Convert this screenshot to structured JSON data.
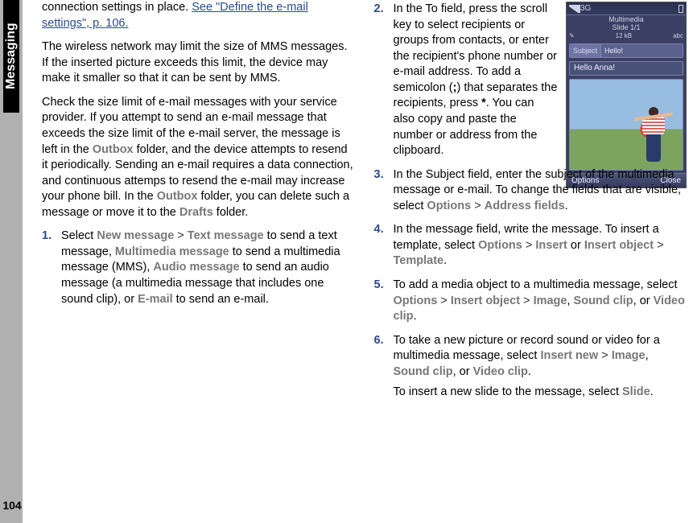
{
  "sideTab": "Messaging",
  "pageNumber": "104",
  "leftCol": {
    "para1_a": "connection settings in place. ",
    "para1_link": "See \"Define the e-mail settings\", p. 106.",
    "para2": "The wireless network may limit the size of MMS messages. If the inserted picture exceeds this limit, the device may make it smaller so that it can be sent by MMS.",
    "para3_a": "Check the size limit of e-mail messages with your service provider. If you attempt to send an e-mail message that exceeds the size limit of the e-mail server, the message is left in the ",
    "para3_outbox": "Outbox",
    "para3_b": " folder, and the device attempts to resend it periodically. Sending an e-mail requires a data connection, and continuous attemps to resend the e-mail may increase your phone bill. In the ",
    "para3_outbox2": "Outbox",
    "para3_c": " folder, you can delete such a message or move it to the ",
    "para3_drafts": "Drafts",
    "para3_d": " folder.",
    "step1_num": "1.",
    "step1_a": "Select ",
    "step1_newmsg": "New message",
    "step1_gt1": "  >  ",
    "step1_textmsg": "Text message",
    "step1_b": " to send a text message, ",
    "step1_mms": "Multimedia message",
    "step1_c": " to send a multimedia message (MMS), ",
    "step1_audio": "Audio message",
    "step1_d": " to send an audio message (a multimedia message that includes one sound clip), or ",
    "step1_email": "E-mail",
    "step1_e": " to send an e-mail."
  },
  "rightCol": {
    "step2_num": "2.",
    "step2_a": "In the To field, press the scroll key to select recipients or groups from contacts, or enter the recipient's phone number or e-mail address. To add a semicolon (",
    "step2_semi": ";",
    "step2_b": ") that separates the recipients, press ",
    "step2_star": "*",
    "step2_c": ". You can also copy and paste the number or address from the clipboard.",
    "step3_num": "3.",
    "step3_a": "In the Subject field, enter the subject of the multimedia message or e-mail. To change the fields that are visible, select ",
    "step3_options": "Options",
    "step3_gt": "  >  ",
    "step3_addr": "Address fields",
    "step3_dot": ".",
    "step4_num": "4.",
    "step4_a": "In the message field, write the message. To insert a template, select ",
    "step4_options": "Options",
    "step4_gt1": "  >  ",
    "step4_insert": "Insert",
    "step4_or": " or ",
    "step4_insertobj": "Insert object",
    "step4_gt2": "  >  ",
    "step4_template": "Template",
    "step4_dot": ".",
    "step5_num": "5.",
    "step5_a": "To add a media object to a multimedia message, select ",
    "step5_options": "Options",
    "step5_gt1": "  >  ",
    "step5_insertobj": "Insert object",
    "step5_gt2": "  >  ",
    "step5_image": "Image",
    "step5_c1": ", ",
    "step5_sound": "Sound clip",
    "step5_c2": ", or ",
    "step5_video": "Video clip",
    "step5_dot": ".",
    "step6_num": "6.",
    "step6_a": "To take a new picture or record sound or video for a multimedia message, select ",
    "step6_insertnew": "Insert new",
    "step6_gt": "  >  ",
    "step6_image": "Image",
    "step6_c1": ", ",
    "step6_sound": "Sound clip",
    "step6_c2": ", or ",
    "step6_video": "Video clip",
    "step6_dot": ".",
    "step6b_a": "To insert a new slide to the message, select ",
    "step6b_slide": "Slide",
    "step6b_dot": "."
  },
  "phone": {
    "net": "3G",
    "title1": "Multimedia",
    "title2": "Slide 1/1",
    "size": "12 kB",
    "mode": "abc",
    "subjectLabel": "Subject",
    "subjectValue": "Hello!",
    "bodyText": "Hello Anna!",
    "leftSoft": "Options",
    "rightSoft": "Close"
  }
}
